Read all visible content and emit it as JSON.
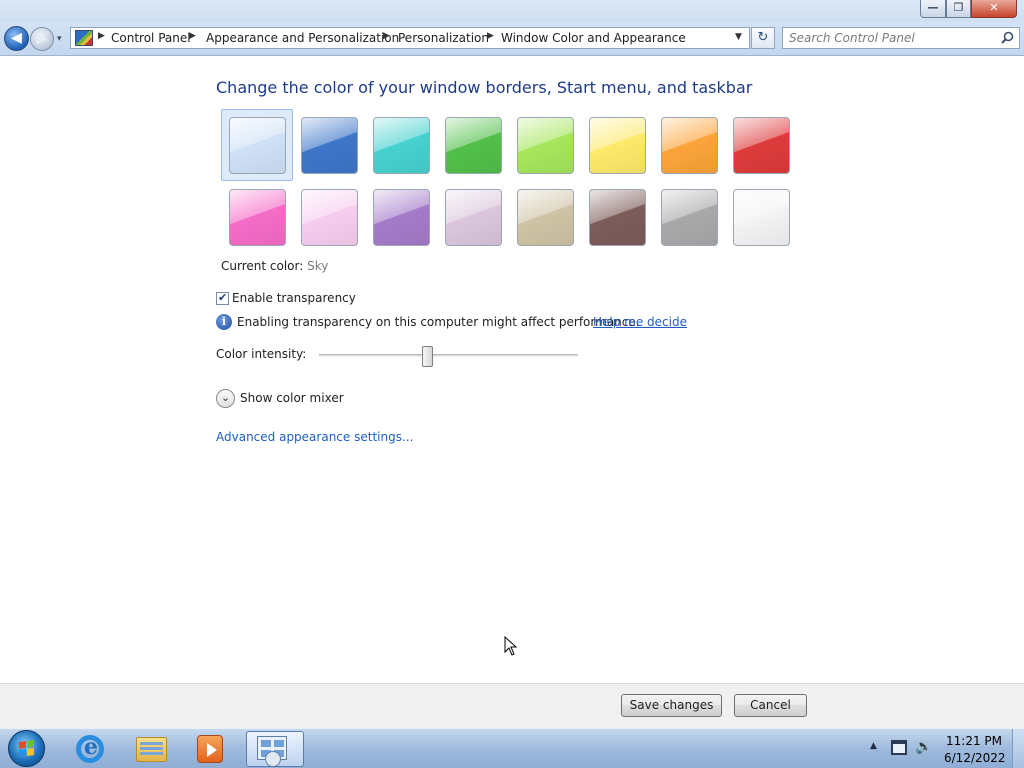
{
  "window": {
    "minimize_icon": "minimize-icon",
    "maximize_icon": "restore-icon",
    "close_icon": "close-icon"
  },
  "nav": {
    "back_glyph": "◀",
    "forward_glyph": "▶",
    "recent_glyph": "▾",
    "breadcrumbs": [
      "Control Panel",
      "Appearance and Personalization",
      "Personalization",
      "Window Color and Appearance"
    ],
    "refresh_glyph": "↻"
  },
  "search": {
    "placeholder": "Search Control Panel"
  },
  "main": {
    "heading": "Change the color of your window borders, Start menu, and taskbar",
    "swatches_row1": [
      {
        "name": "Sky",
        "color": "#cfe1f7",
        "selected": true
      },
      {
        "name": "Twilight",
        "color": "#3e76c9"
      },
      {
        "name": "Sea",
        "color": "#46d1cf"
      },
      {
        "name": "Leaf",
        "color": "#52c04a"
      },
      {
        "name": "Lime",
        "color": "#a6e65c"
      },
      {
        "name": "Sun",
        "color": "#fde96a"
      },
      {
        "name": "Pumpkin",
        "color": "#fba43a"
      },
      {
        "name": "Ruby",
        "color": "#dd3b3b"
      }
    ],
    "swatches_row2": [
      {
        "name": "Fuchsia",
        "color": "#f56cc8"
      },
      {
        "name": "Blush",
        "color": "#f7cdef"
      },
      {
        "name": "Violet",
        "color": "#a47bc9"
      },
      {
        "name": "Lavender",
        "color": "#dbc6dd"
      },
      {
        "name": "Taupe",
        "color": "#cfc3a5"
      },
      {
        "name": "Chocolate",
        "color": "#7d5c5a"
      },
      {
        "name": "Slate",
        "color": "#a9a9a9"
      },
      {
        "name": "Frost",
        "color": "#f3f3f3"
      }
    ],
    "current_color_label": "Current color:",
    "current_color_value": "Sky",
    "transparency_label": "Enable transparency",
    "transparency_checked": true,
    "info_icon": "info-icon",
    "info_text": "Enabling transparency on this computer might affect performance.",
    "help_link": "Help me decide",
    "intensity_label": "Color intensity:",
    "intensity_value": 0.42,
    "mixer_label": "Show color mixer",
    "mixer_glyph": "⌄",
    "advanced_link": "Advanced appearance settings..."
  },
  "commands": {
    "save_label": "Save changes",
    "cancel_label": "Cancel"
  },
  "taskbar": {
    "apps": [
      "internet-explorer-icon",
      "windows-explorer-icon",
      "media-player-icon",
      "control-panel-icon"
    ],
    "tray_arrow": "▲",
    "volume_glyph": "🔉",
    "clock_time": "11:21 PM",
    "clock_date": "6/12/2022"
  }
}
